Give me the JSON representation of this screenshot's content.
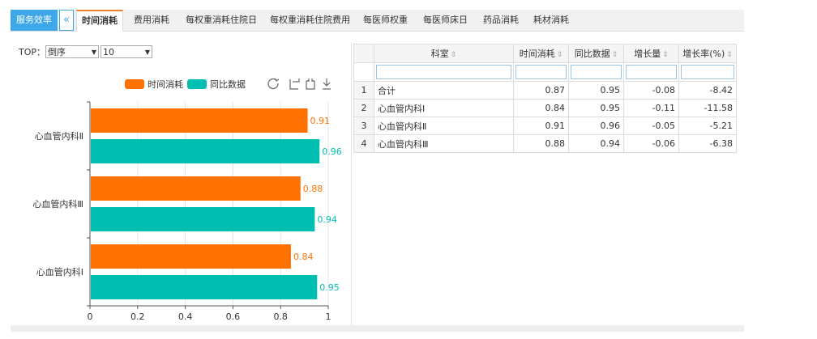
{
  "header": {
    "badge": "服务效率",
    "collapse_icon": "«",
    "tabs": [
      {
        "label": "时间消耗",
        "active": true
      },
      {
        "label": "费用消耗",
        "active": false
      },
      {
        "label": "每权重消耗住院日",
        "active": false
      },
      {
        "label": "每权重消耗住院费用",
        "active": false
      },
      {
        "label": "每医师权重",
        "active": false
      },
      {
        "label": "每医师床日",
        "active": false
      },
      {
        "label": "药品消耗",
        "active": false
      },
      {
        "label": "耗材消耗",
        "active": false
      }
    ]
  },
  "controls": {
    "top_label": "TOP：",
    "order_value": "倒序",
    "count_value": "10"
  },
  "chart_data": {
    "type": "bar",
    "orientation": "horizontal",
    "categories": [
      "心血管内科Ⅱ",
      "心血管内科Ⅲ",
      "心血管内科Ⅰ"
    ],
    "series": [
      {
        "name": "时间消耗",
        "values": [
          0.91,
          0.88,
          0.84
        ],
        "color": "#ff7100",
        "labels": [
          "0.91",
          "0.88",
          "0.84"
        ]
      },
      {
        "name": "同比数据",
        "values": [
          0.96,
          0.94,
          0.95
        ],
        "color": "#00bfb0",
        "labels": [
          "0.96",
          "0.94",
          "0.95"
        ]
      }
    ],
    "xlim": [
      0,
      1
    ],
    "xticks": [
      "0",
      "0.2",
      "0.4",
      "0.6",
      "0.8",
      "1"
    ],
    "grid": true,
    "legend": "top"
  },
  "toolbox": [
    "restore-icon",
    "bar-switch-icon",
    "stack-switch-icon",
    "download-icon"
  ],
  "table": {
    "columns": [
      "科室",
      "时间消耗",
      "同比数据",
      "增长量",
      "增长率(%)"
    ],
    "rows": [
      {
        "n": "1",
        "dept": "合计",
        "time": "0.87",
        "yoy": "0.95",
        "inc": "-0.08",
        "rate": "-8.42"
      },
      {
        "n": "2",
        "dept": "心血管内科Ⅰ",
        "time": "0.84",
        "yoy": "0.95",
        "inc": "-0.11",
        "rate": "-11.58"
      },
      {
        "n": "3",
        "dept": "心血管内科Ⅱ",
        "time": "0.91",
        "yoy": "0.96",
        "inc": "-0.05",
        "rate": "-5.21"
      },
      {
        "n": "4",
        "dept": "心血管内科Ⅲ",
        "time": "0.88",
        "yoy": "0.94",
        "inc": "-0.06",
        "rate": "-6.38"
      }
    ]
  }
}
